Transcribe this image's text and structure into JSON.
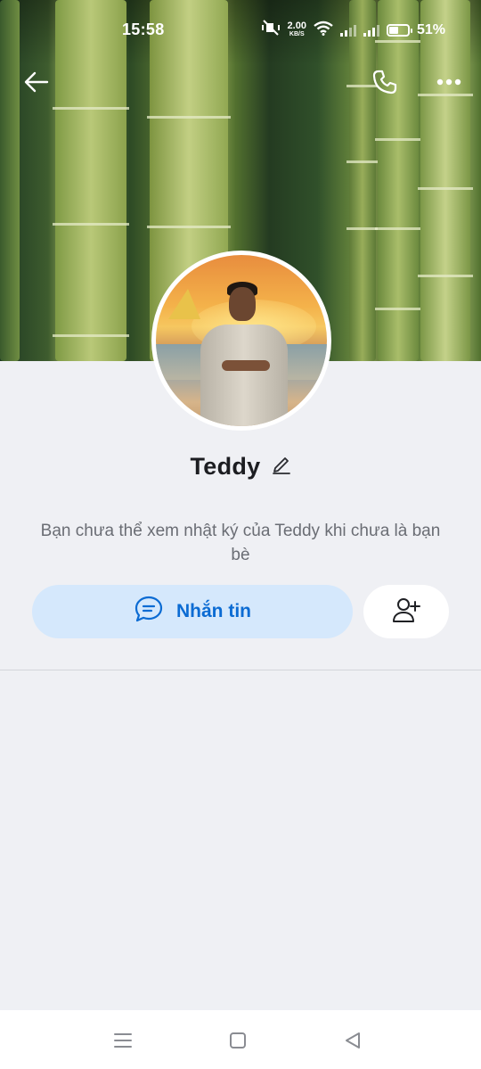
{
  "status_bar": {
    "time": "15:58",
    "net_speed": "2.00",
    "net_unit": "KB/S",
    "battery": "51%",
    "battery_level": 0.51
  },
  "header": {
    "back_icon": "arrow-left-icon",
    "call_icon": "phone-icon",
    "more_icon": "more-horizontal-icon"
  },
  "profile": {
    "name": "Teddy",
    "edit_icon": "pencil-icon",
    "description": "Bạn chưa thể xem nhật ký của Teddy khi chưa là bạn bè"
  },
  "actions": {
    "message_label": "Nhắn tin",
    "message_icon": "chat-bubble-icon",
    "add_friend_icon": "add-user-icon"
  },
  "colors": {
    "accent": "#0b6bd3",
    "message_button_bg": "#d5e8fc",
    "page_bg": "#eff0f4"
  },
  "nav_bar": {
    "menu_icon": "menu-icon",
    "home_icon": "home-square-icon",
    "back_icon": "triangle-back-icon"
  }
}
